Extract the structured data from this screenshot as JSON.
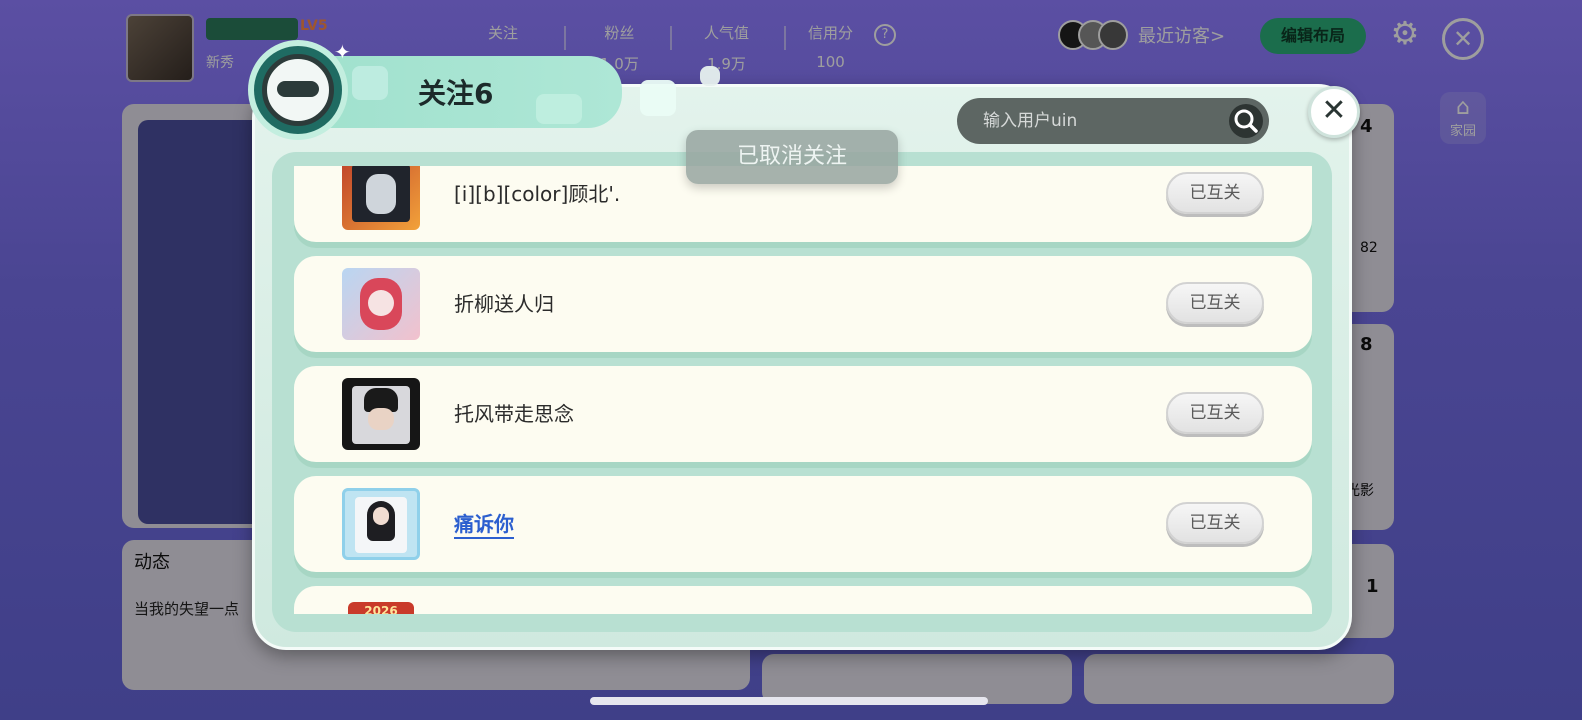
{
  "background": {
    "profile": {
      "level": "LV5",
      "sub_label": "新秀"
    },
    "stats": [
      {
        "label": "关注",
        "value": ""
      },
      {
        "label": "粉丝",
        "value": "1.0万"
      },
      {
        "label": "人气值",
        "value": "1.9万"
      },
      {
        "label": "信用分",
        "value": "100"
      }
    ],
    "help_icon": "?",
    "recent_visitors_label": "最近访客>",
    "edit_layout_label": "编辑布局",
    "home_label": "家园",
    "dynamics_title": "动态",
    "dynamics_text": "当我的失望一点",
    "side_counts": [
      "4",
      "8",
      "1"
    ],
    "side_texts": [
      "82",
      "光影"
    ]
  },
  "modal": {
    "title": "关注6",
    "search": {
      "placeholder": "输入用户uin"
    },
    "toast": "已取消关注",
    "close_icon": "close-icon",
    "following": [
      {
        "name": "[i][b][color]顾北'.",
        "button": "已互关",
        "link": false
      },
      {
        "name": "折柳送人归",
        "button": "已互关",
        "link": false
      },
      {
        "name": "托风带走思念",
        "button": "已互关",
        "link": false
      },
      {
        "name": "痛诉你",
        "button": "已互关",
        "link": true
      },
      {
        "name": "",
        "button": "",
        "badge": "2026",
        "link": false
      }
    ]
  },
  "colors": {
    "modal_bg": "#e3f3ec",
    "row_bg": "#fdfcf1",
    "link": "#2c5fcf",
    "edit_button": "#2bb07a"
  }
}
